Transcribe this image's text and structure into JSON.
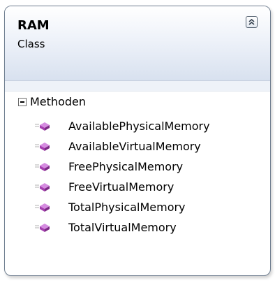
{
  "class": {
    "name": "RAM",
    "kind": "Class"
  },
  "header": {
    "collapse_icon": "double-chevron-up-icon"
  },
  "section": {
    "label": "Methoden",
    "toggle_icon": "collapse-minus-icon"
  },
  "methods": [
    {
      "name": "AvailablePhysicalMemory",
      "icon": "public-method-icon"
    },
    {
      "name": "AvailableVirtualMemory",
      "icon": "public-method-icon"
    },
    {
      "name": "FreePhysicalMemory",
      "icon": "public-method-icon"
    },
    {
      "name": "FreeVirtualMemory",
      "icon": "public-method-icon"
    },
    {
      "name": "TotalPhysicalMemory",
      "icon": "public-method-icon"
    },
    {
      "name": "TotalVirtualMemory",
      "icon": "public-method-icon"
    }
  ],
  "colors": {
    "method_icon": "#a63fb0",
    "header_gradient_end": "#d8e1ef",
    "border": "#6e7d8f"
  }
}
